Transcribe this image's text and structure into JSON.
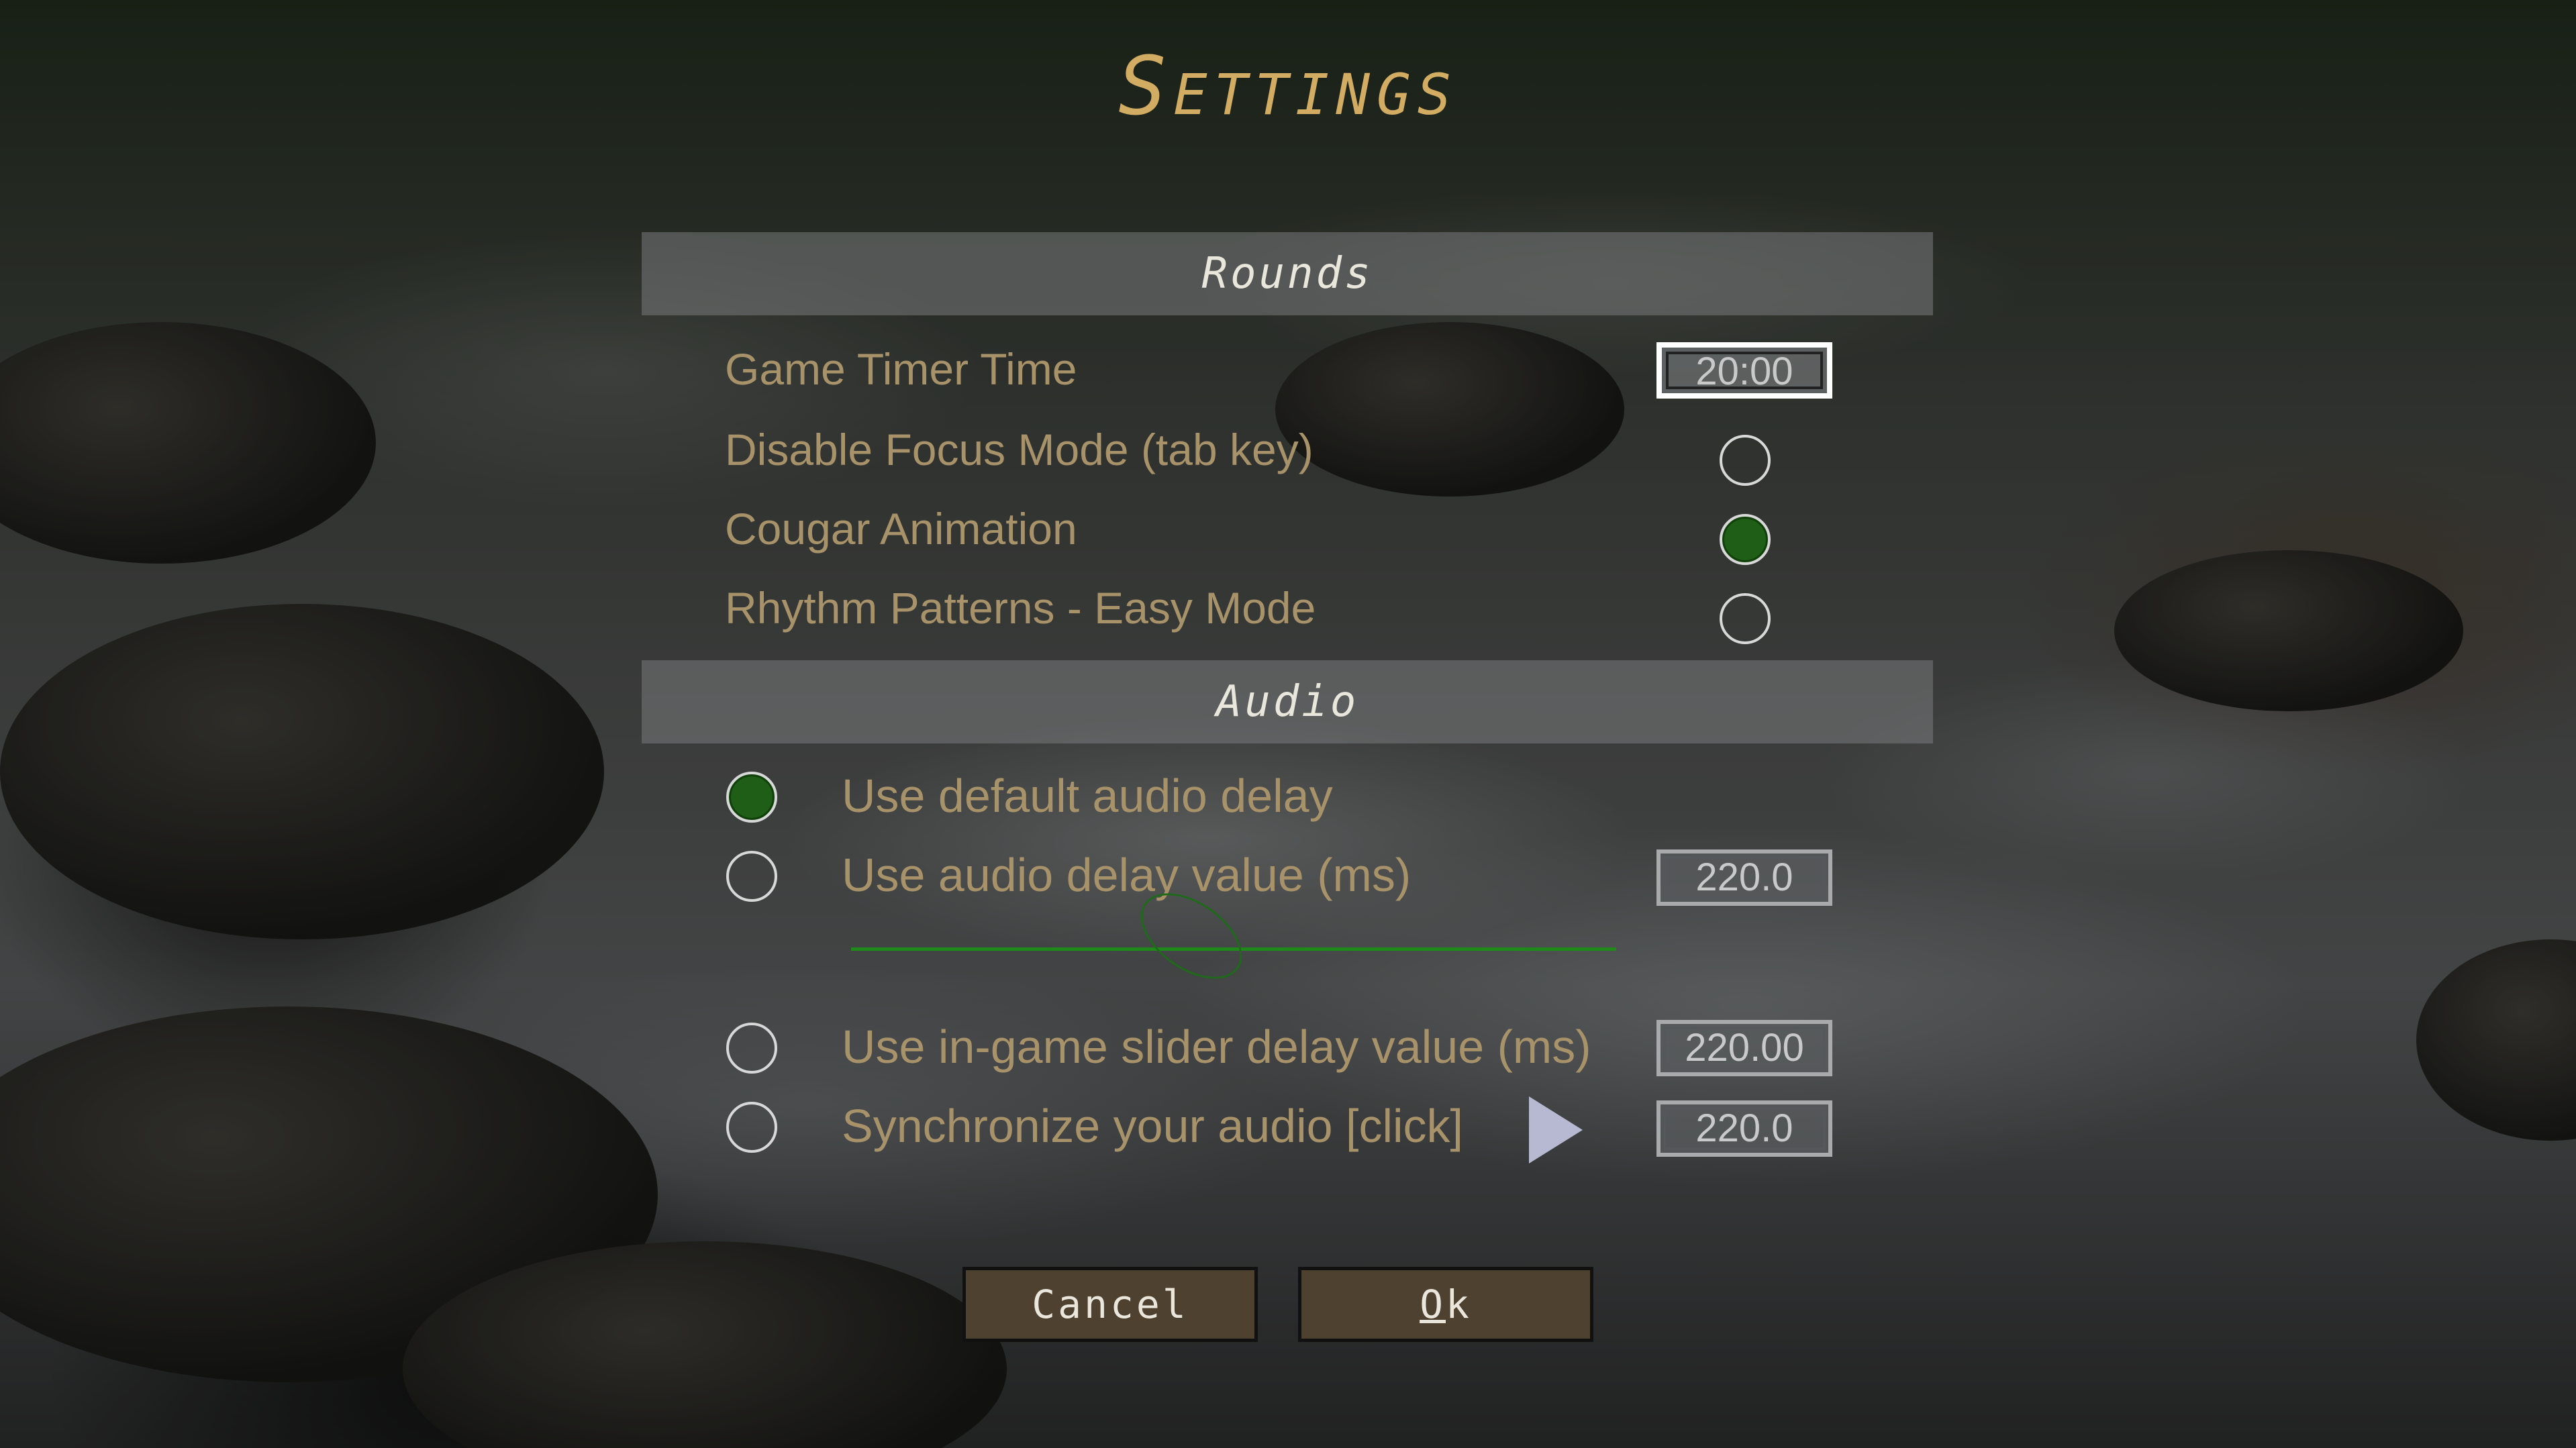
{
  "title": "Settings",
  "sections": {
    "rounds": {
      "header": "Rounds",
      "game_timer": {
        "label": "Game Timer Time",
        "value": "20:00"
      },
      "disable_focus": {
        "label": "Disable Focus Mode (tab key)",
        "checked": false
      },
      "cougar_animation": {
        "label": "Cougar Animation",
        "checked": true
      },
      "rhythm_easy": {
        "label": "Rhythm Patterns - Easy Mode",
        "checked": false
      }
    },
    "audio": {
      "header": "Audio",
      "default_delay": {
        "label": "Use default audio delay",
        "selected": true
      },
      "delay_value": {
        "label": "Use audio delay value (ms)",
        "value": "220.0",
        "selected": false
      },
      "slider_delay": {
        "label": "Use in-game slider delay value (ms)",
        "value": "220.00",
        "selected": false
      },
      "sync_audio": {
        "label": "Synchronize your audio [click]",
        "value": "220.0",
        "selected": false
      }
    }
  },
  "buttons": {
    "cancel": "Cancel",
    "ok_first": "O",
    "ok_rest": "k"
  },
  "colors": {
    "title": "#d2ac62",
    "label": "#a8926a",
    "radio_on": "#1e5e16",
    "button_bg": "#4e4130",
    "slider": "#1f8a1a"
  },
  "icons": {
    "play": "play-icon"
  }
}
